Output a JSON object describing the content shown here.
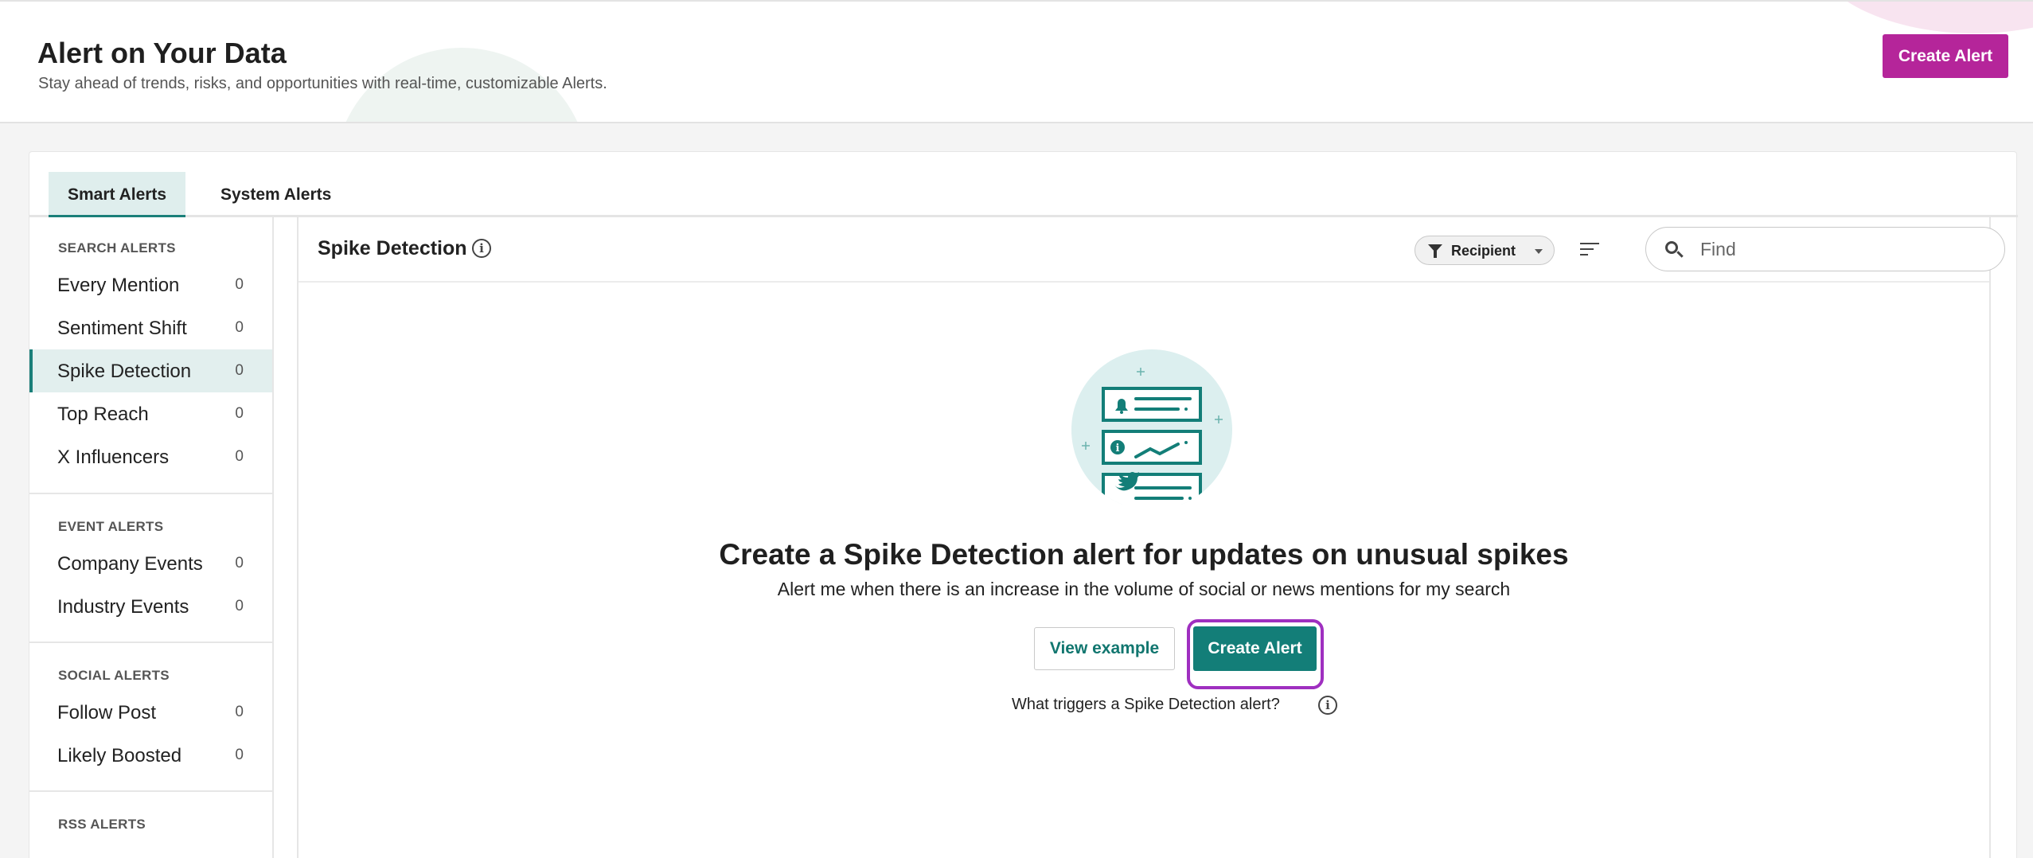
{
  "header": {
    "title": "Alert on Your Data",
    "subtitle": "Stay ahead of trends, risks, and opportunities with real-time, customizable Alerts.",
    "create_button": "Create Alert"
  },
  "tabs": [
    {
      "label": "Smart Alerts",
      "active": true
    },
    {
      "label": "System Alerts",
      "active": false
    }
  ],
  "sidebar": {
    "sections": [
      {
        "title": "SEARCH ALERTS",
        "items": [
          {
            "label": "Every Mention",
            "count": "0"
          },
          {
            "label": "Sentiment Shift",
            "count": "0"
          },
          {
            "label": "Spike Detection",
            "count": "0",
            "active": true
          },
          {
            "label": "Top Reach",
            "count": "0"
          },
          {
            "label": "X Influencers",
            "count": "0"
          }
        ]
      },
      {
        "title": "EVENT ALERTS",
        "items": [
          {
            "label": "Company Events",
            "count": "0"
          },
          {
            "label": "Industry Events",
            "count": "0"
          }
        ]
      },
      {
        "title": "SOCIAL ALERTS",
        "items": [
          {
            "label": "Follow Post",
            "count": "0"
          },
          {
            "label": "Likely Boosted",
            "count": "0"
          }
        ]
      },
      {
        "title": "RSS ALERTS",
        "items": []
      }
    ]
  },
  "main": {
    "title": "Spike Detection",
    "filter_label": "Recipient",
    "search_placeholder": "Find",
    "empty_title": "Create a Spike Detection alert for updates on unusual spikes",
    "empty_subtitle": "Alert me when there is an increase in the volume of social or news mentions for my search",
    "view_example": "View example",
    "create_alert": "Create Alert",
    "triggers_text": "What triggers a Spike Detection alert?"
  },
  "colors": {
    "brand_magenta": "#b5259a",
    "teal": "#137e78",
    "highlight_purple": "#9f2fc0"
  },
  "icons": [
    "info-icon",
    "filter-icon",
    "caret-down-icon",
    "sort-icon",
    "search-icon",
    "bell-icon",
    "twitter-icon"
  ]
}
